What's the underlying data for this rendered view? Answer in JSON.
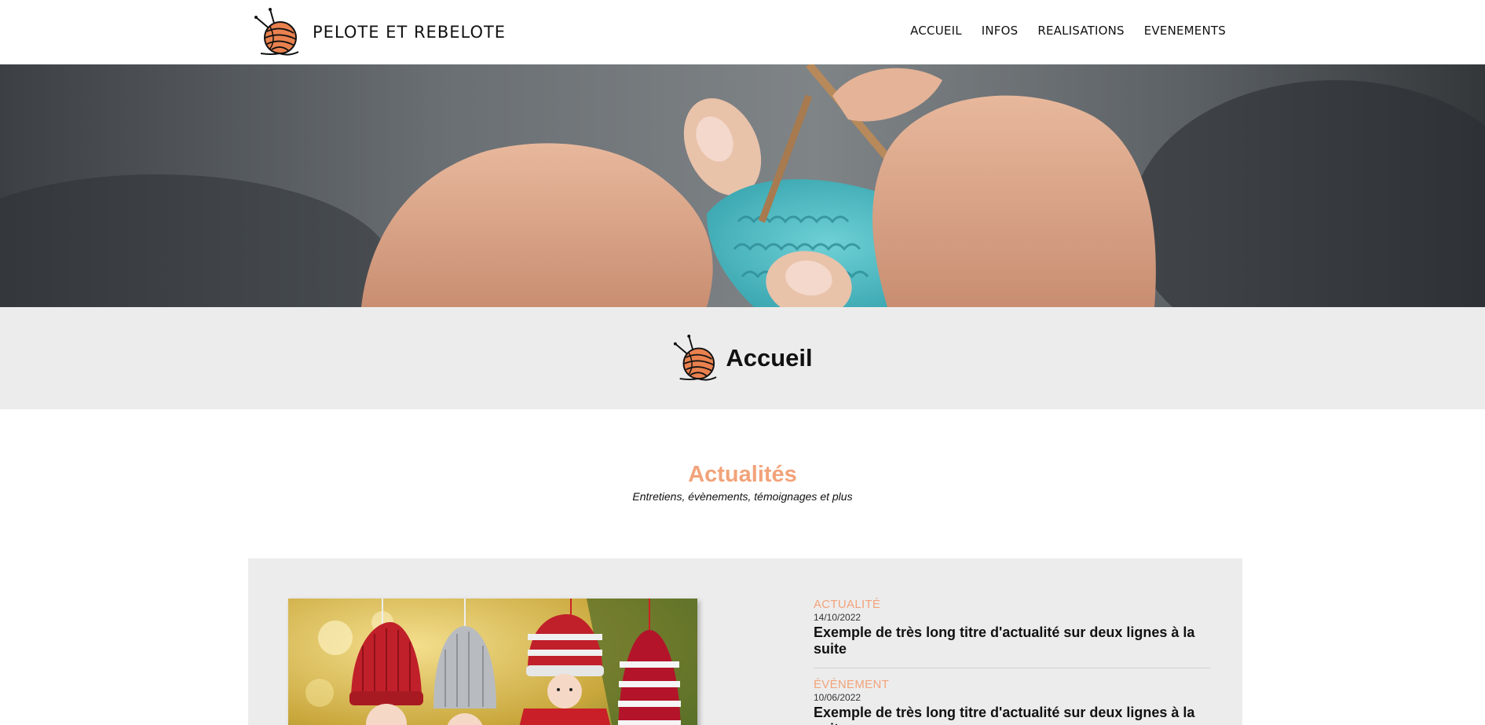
{
  "header": {
    "logo_icon": "yarn-ball-icon",
    "site_name": "PELOTE ET REBELOTE",
    "nav": [
      {
        "label": "ACCUEIL"
      },
      {
        "label": "INFOS"
      },
      {
        "label": "REALISATIONS"
      },
      {
        "label": "EVENEMENTS"
      }
    ]
  },
  "hero": {
    "image": "hands-knitting-photo"
  },
  "page": {
    "title_icon": "yarn-ball-icon",
    "title": "Accueil"
  },
  "news": {
    "title": "Actualités",
    "subtitle": "Entretiens, évènements, témoignages et plus",
    "featured_image": "knitted-dolls-photo",
    "articles": [
      {
        "category": "ACTUALITÉ",
        "date": "14/10/2022",
        "title": "Exemple de très long titre d'actualité sur deux lignes à la suite"
      },
      {
        "category": "ÉVÉNEMENT",
        "date": "10/06/2022",
        "title": "Exemple de très long titre d'actualité sur deux lignes à la suite"
      }
    ]
  },
  "colors": {
    "accent": "#f2a37a",
    "band_bg": "#ececec",
    "yarn": "#e9814f"
  }
}
